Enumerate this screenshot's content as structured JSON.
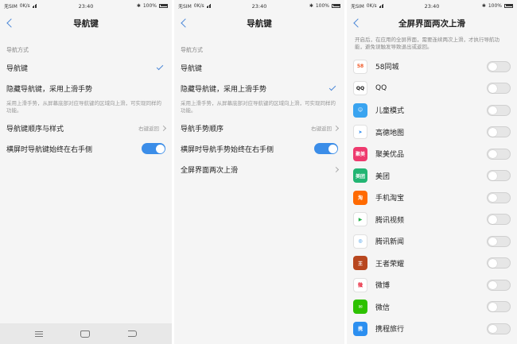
{
  "status": {
    "carrier": "无SIM",
    "speed": "0K/s",
    "time": "23:40",
    "battery": "100%"
  },
  "panel1": {
    "title": "导航键",
    "section": "导航方式",
    "opt_nav": "导航键",
    "opt_gesture": "隐藏导航键，采用上滑手势",
    "desc": "采用上滑手势，从屏幕底部对应导航键的区域向上滑，可实现同样的功能。",
    "order_label": "导航键顺序与样式",
    "order_value": "右键返回",
    "landscape_label": "横屏时导航键始终在右手侧"
  },
  "panel2": {
    "title": "导航键",
    "section": "导航方式",
    "opt_nav": "导航键",
    "opt_gesture": "隐藏导航键，采用上滑手势",
    "desc": "采用上滑手势，从屏幕底部对应导航键的区域向上滑，可实现同样的功能。",
    "order_label": "导航手势顺序",
    "order_value": "右键返回",
    "landscape_label": "横屏时导航手势始终在右手侧",
    "fullscreen_label": "全屏界面两次上滑"
  },
  "panel3": {
    "title": "全屏界面两次上滑",
    "desc": "开启后，在应用的全屏界面，需要连续两次上滑，才执行导航功能，避免误触发导致退出或返回。",
    "apps": [
      {
        "name": "58同城",
        "icon": "58",
        "color": "#ffffff",
        "text_color": "#f05a28"
      },
      {
        "name": "QQ",
        "icon": "QQ",
        "color": "#ffffff",
        "text_color": "#111111"
      },
      {
        "name": "儿童模式",
        "icon": "☺",
        "color": "#3aa4f0",
        "text_color": "#ffffff"
      },
      {
        "name": "高德地图",
        "icon": "➤",
        "color": "#ffffff",
        "text_color": "#2d8cf0"
      },
      {
        "name": "聚美优品",
        "icon": "聚美",
        "color": "#ee3a6e",
        "text_color": "#ffffff"
      },
      {
        "name": "美团",
        "icon": "美团",
        "color": "#22b573",
        "text_color": "#ffffff"
      },
      {
        "name": "手机淘宝",
        "icon": "淘",
        "color": "#ff6a00",
        "text_color": "#ffffff"
      },
      {
        "name": "腾讯视频",
        "icon": "▶",
        "color": "#ffffff",
        "text_color": "#2ab24f"
      },
      {
        "name": "腾讯新闻",
        "icon": "◎",
        "color": "#ffffff",
        "text_color": "#1e88e5"
      },
      {
        "name": "王者荣耀",
        "icon": "王",
        "color": "#b8471f",
        "text_color": "#ffffff"
      },
      {
        "name": "微博",
        "icon": "微",
        "color": "#ffffff",
        "text_color": "#e6162d"
      },
      {
        "name": "微信",
        "icon": "✉",
        "color": "#2dc100",
        "text_color": "#ffffff"
      },
      {
        "name": "携程旅行",
        "icon": "携",
        "color": "#2c8ff0",
        "text_color": "#ffffff"
      }
    ]
  },
  "colors": {
    "accent": "#3b8de8",
    "background": "#f5f5f5"
  }
}
